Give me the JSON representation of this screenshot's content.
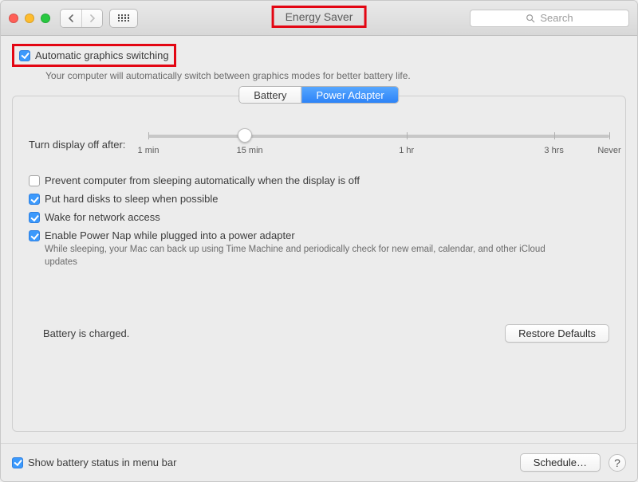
{
  "window": {
    "title": "Energy Saver",
    "search_placeholder": "Search"
  },
  "auto_graphics": {
    "label": "Automatic graphics switching",
    "checked": true,
    "description": "Your computer will automatically switch between graphics modes for better battery life."
  },
  "tabs": {
    "battery": "Battery",
    "power_adapter": "Power Adapter",
    "active": "power_adapter"
  },
  "slider": {
    "label": "Turn display off after:",
    "ticks": {
      "t1": "1 min",
      "t15": "15 min",
      "t60": "1 hr",
      "t180": "3 hrs",
      "never": "Never"
    }
  },
  "options": {
    "prevent_sleep": {
      "label": "Prevent computer from sleeping automatically when the display is off",
      "checked": false
    },
    "hard_disks": {
      "label": "Put hard disks to sleep when possible",
      "checked": true
    },
    "wake_network": {
      "label": "Wake for network access",
      "checked": true
    },
    "power_nap": {
      "label": "Enable Power Nap while plugged into a power adapter",
      "checked": true,
      "sub": "While sleeping, your Mac can back up using Time Machine and periodically check for new email, calendar, and other iCloud updates"
    }
  },
  "status": "Battery is charged.",
  "buttons": {
    "restore": "Restore Defaults",
    "schedule": "Schedule…"
  },
  "menubar_status": {
    "label": "Show battery status in menu bar",
    "checked": true
  }
}
